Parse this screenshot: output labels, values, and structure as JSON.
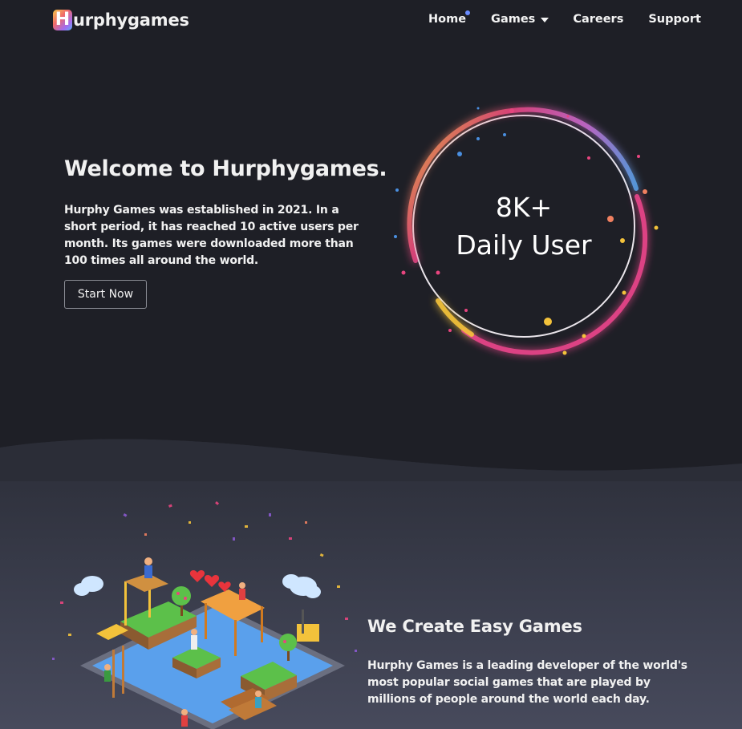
{
  "nav": {
    "logo_initial": "H",
    "logo_rest": "urphygames",
    "links": [
      "Home",
      "Games",
      "Careers",
      "Support"
    ]
  },
  "hero": {
    "title": "Welcome to Hurphygames.",
    "text": "Hurphy Games was established in 2021. In a short period, it has reached 10 active users per month. Its games were downloaded more than 100 times all around the world.",
    "cta": "Start Now"
  },
  "stat": {
    "value": "8K+",
    "label": "Daily User"
  },
  "about": {
    "title": "We Create Easy Games",
    "text": "Hurphy Games is a leading developer of the world's most popular social games that are played by millions of people around the world each day."
  },
  "colors": {
    "background": "#1e1f26",
    "ring_pink": "#e8457f",
    "ring_blue": "#5aa2e8",
    "ring_yellow": "#f3c23b",
    "accent_dot": "#6a8cff"
  }
}
